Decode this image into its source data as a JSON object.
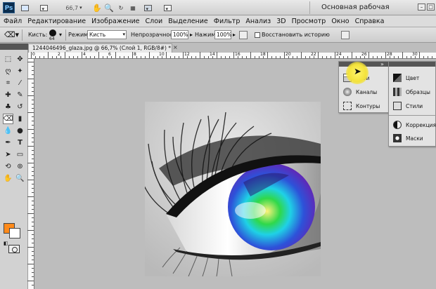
{
  "appbar": {
    "logo": "Ps",
    "zoom": "66,7",
    "workspace": "Основная рабочая среда",
    "window_buttons": [
      "–",
      "□",
      "×"
    ]
  },
  "menu": {
    "items": [
      "Файл",
      "Редактирование",
      "Изображение",
      "Слои",
      "Выделение",
      "Фильтр",
      "Анализ",
      "3D",
      "Просмотр",
      "Окно",
      "Справка"
    ]
  },
  "options": {
    "brush_label": "Кисть:",
    "brush_size": "64",
    "mode_label": "Режим:",
    "mode_value": "Кисть",
    "opacity_label": "Непрозрачность:",
    "opacity_value": "100%",
    "pressure_label": "Нажим:",
    "pressure_value": "100%",
    "restore_label": "Восстановить историю"
  },
  "document": {
    "tab_title": "1244046496_glaza.jpg @ 66,7% (Слой 1, RGB/8#) *",
    "close": "×"
  },
  "ruler": {
    "top_labels": [
      "0",
      "2",
      "4",
      "6",
      "8",
      "10",
      "12",
      "14",
      "16",
      "18",
      "20",
      "22",
      "24",
      "26",
      "28",
      "30"
    ]
  },
  "tools": {
    "fg_color": "#ff8a1a",
    "bg_color": "#ffffff"
  },
  "panels": {
    "left_dock": [
      {
        "label": "Слои",
        "icon": "layers-icon"
      },
      {
        "label": "Каналы",
        "icon": "channels-icon"
      },
      {
        "label": "Контуры",
        "icon": "paths-icon"
      }
    ],
    "right_dock_group1": [
      {
        "label": "Цвет",
        "icon": "color-icon"
      },
      {
        "label": "Образцы",
        "icon": "swatches-icon"
      },
      {
        "label": "Стили",
        "icon": "styles-icon"
      }
    ],
    "right_dock_group2": [
      {
        "label": "Коррекция",
        "icon": "adjustments-icon"
      },
      {
        "label": "Маски",
        "icon": "masks-icon"
      }
    ],
    "collapse": "»"
  }
}
